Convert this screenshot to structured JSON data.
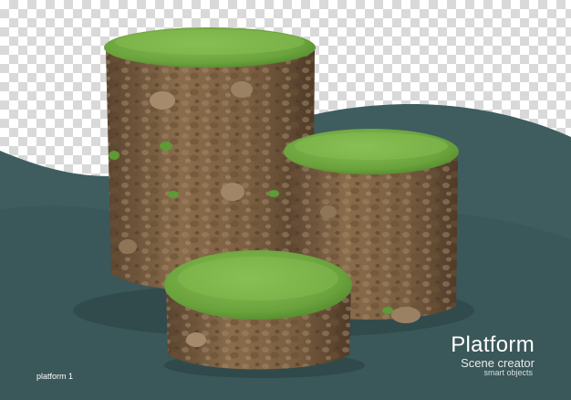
{
  "scene": {
    "title": "Platform",
    "subtitle": "Scene creator",
    "subtitle2": "smart objects",
    "caption": "platform 1"
  },
  "colors": {
    "teal_background": "#3f5d5f",
    "teal_wave": "#365456",
    "grass": "#6fa83f",
    "grass_dark": "#4f8a2c",
    "soil": "#7d6142",
    "soil_dark": "#5a4430",
    "rock": "#a08a72"
  }
}
